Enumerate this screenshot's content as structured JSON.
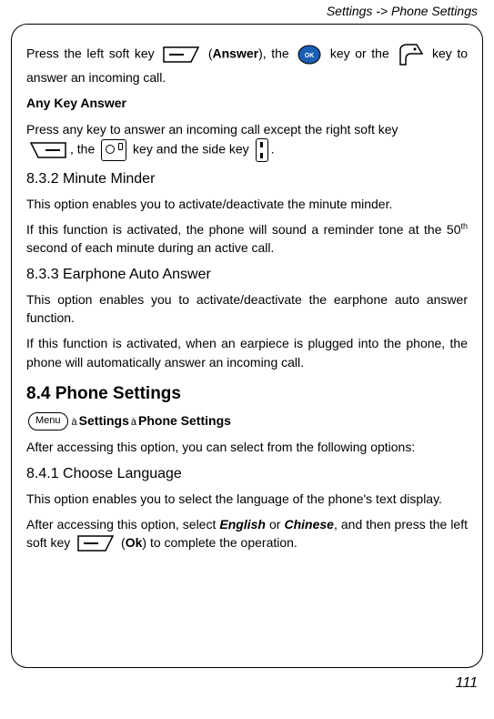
{
  "header": {
    "breadcrumb": "Settings -> Phone Settings"
  },
  "sec831": {
    "line1a": "Press the left soft key ",
    "line1b": " (",
    "answer": "Answer",
    "line1c": "), the ",
    "line1d": " key or the ",
    "line1e": " key to answer an incoming call.",
    "any_key_title": "Any Key Answer",
    "line2a": "Press any key to answer an incoming call except the right soft key ",
    "line2b": ", the ",
    "line2c": " key and the side key ",
    "line2d": "."
  },
  "sec832": {
    "title": "8.3.2 Minute Minder",
    "p1": "This option enables you to activate/deactivate the minute minder.",
    "p2a": "If this function is activated, the phone will sound a reminder tone at the 50",
    "p2sup": "th",
    "p2b": " second of each minute during an active call."
  },
  "sec833": {
    "title": "8.3.3 Earphone Auto Answer",
    "p1": "This option enables you to activate/deactivate the earphone auto answer function.",
    "p2": "If this function is activated, when an earpiece is plugged into the phone, the phone will automatically answer an incoming call."
  },
  "sec84": {
    "title": "8.4 Phone Settings",
    "menu_label": "Menu",
    "nav1": "Settings",
    "nav2": "Phone Settings",
    "p1": "After accessing this option, you can select from the following options:"
  },
  "sec841": {
    "title": "8.4.1 Choose Language",
    "p1": "This option enables you to select the language of the phone's text display.",
    "p2a": "After accessing this option, select ",
    "english": "English",
    "p2b": " or ",
    "chinese": "Chinese",
    "p2c": ", and then press the left soft key ",
    "p2d": " (",
    "ok": "Ok",
    "p2e": ") to complete the operation."
  },
  "page_number": "111"
}
